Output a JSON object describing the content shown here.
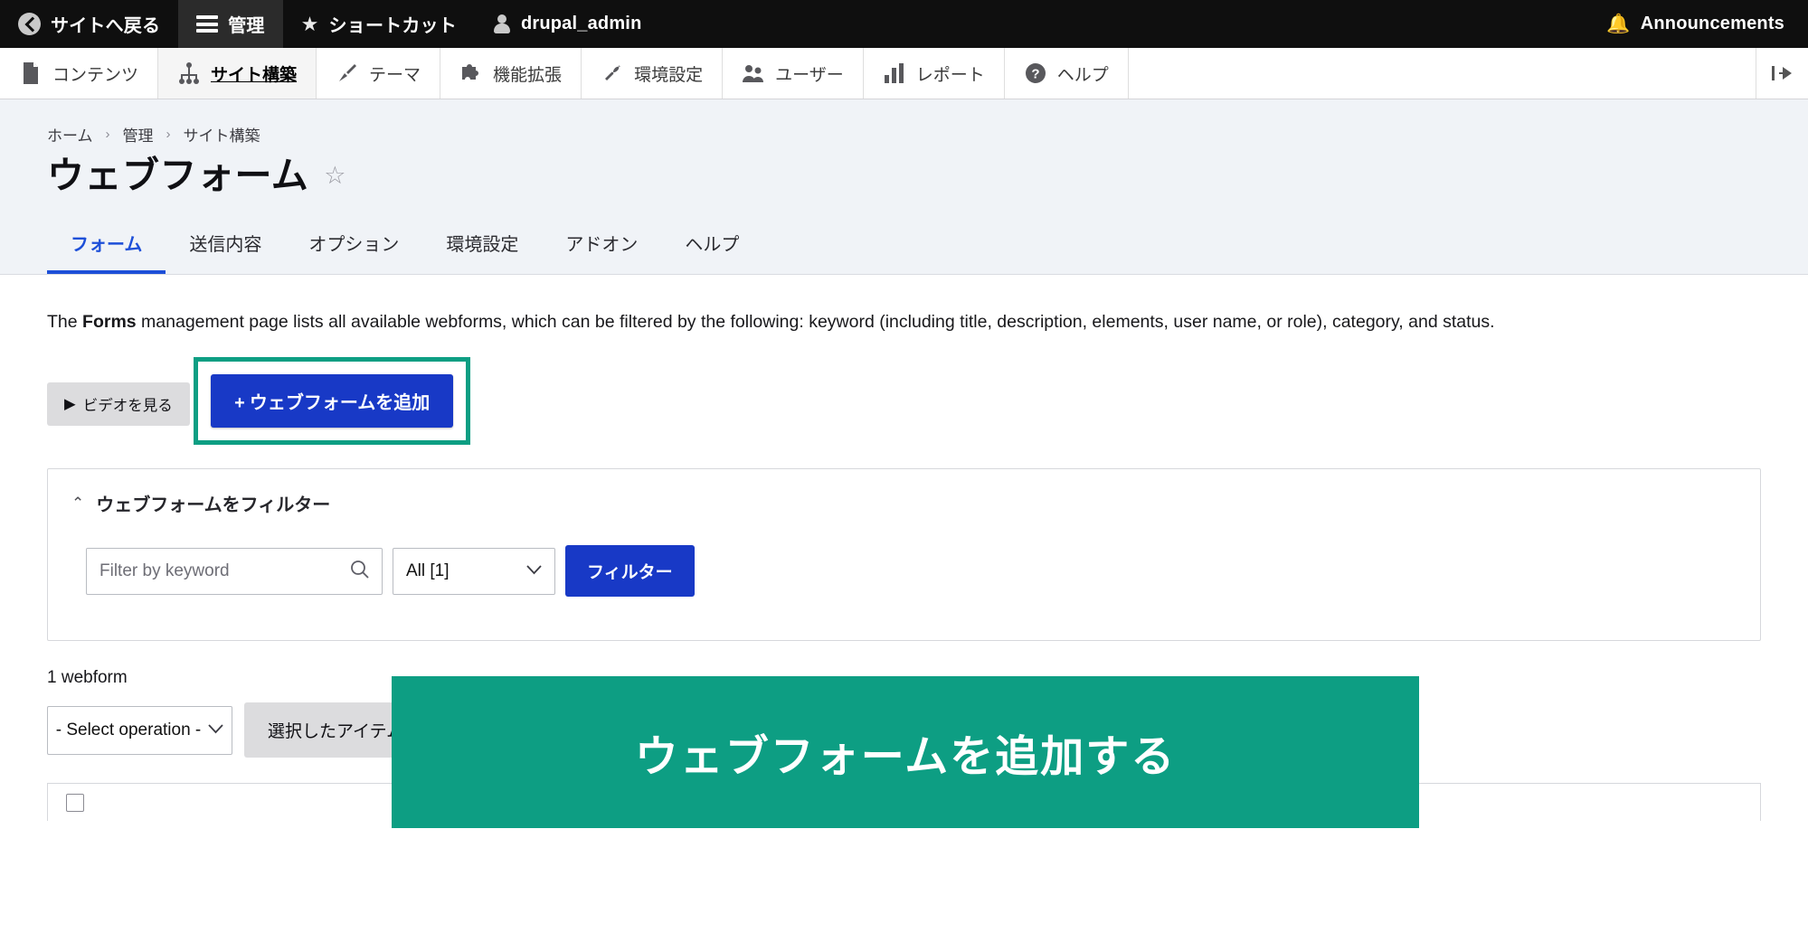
{
  "admin_bar": {
    "items": [
      {
        "icon": "back-arrow-icon",
        "label": "サイトへ戻る"
      },
      {
        "icon": "hamburger-icon",
        "label": "管理"
      },
      {
        "icon": "star-icon",
        "label": "ショートカット"
      },
      {
        "icon": "user-icon",
        "label": "drupal_admin"
      }
    ],
    "announcements": {
      "icon": "bell-icon",
      "label": "Announcements"
    }
  },
  "menu_bar": {
    "items": [
      {
        "icon": "document-icon",
        "label": "コンテンツ"
      },
      {
        "icon": "structure-icon",
        "label": "サイト構築"
      },
      {
        "icon": "paintbrush-icon",
        "label": "テーマ"
      },
      {
        "icon": "puzzle-icon",
        "label": "機能拡張"
      },
      {
        "icon": "wrench-icon",
        "label": "環境設定"
      },
      {
        "icon": "people-icon",
        "label": "ユーザー"
      },
      {
        "icon": "bar-chart-icon",
        "label": "レポート"
      },
      {
        "icon": "question-mark-icon",
        "label": "ヘルプ"
      }
    ],
    "collapse_icon": "collapse-panel-icon"
  },
  "breadcrumb": {
    "items": [
      "ホーム",
      "管理",
      "サイト構築"
    ],
    "separator": "›"
  },
  "page": {
    "title": "ウェブフォーム",
    "star_icon": "☆"
  },
  "tabs": [
    {
      "label": "フォーム",
      "active": true
    },
    {
      "label": "送信内容",
      "active": false
    },
    {
      "label": "オプション",
      "active": false
    },
    {
      "label": "環境設定",
      "active": false
    },
    {
      "label": "アドオン",
      "active": false
    },
    {
      "label": "ヘルプ",
      "active": false
    }
  ],
  "intro": {
    "prefix": "The ",
    "bold": "Forms",
    "suffix": " management page lists all available webforms, which can be filtered by the following: keyword (including title, description, elements, user name, or role), category, and status."
  },
  "video_button": {
    "icon": "▶",
    "label": "ビデオを見る"
  },
  "add_button": {
    "plus": "+",
    "label": "ウェブフォームを追加"
  },
  "filter_panel": {
    "collapse_icon": "⌃",
    "title": "ウェブフォームをフィルター",
    "keyword": {
      "value": "",
      "placeholder": "Filter by keyword",
      "icon": "search-icon"
    },
    "category": {
      "selected": "All [1]",
      "chevron": "⌄"
    },
    "submit_label": "フィルター"
  },
  "results": {
    "count_label": "1 webform",
    "operation_select": {
      "selected": "- Select operation -",
      "chevron": "⌄"
    },
    "apply_label": "選択したアイテムに適用"
  },
  "callout": {
    "text": "ウェブフォームを追加する",
    "color": "#0d9e83"
  },
  "colors": {
    "admin_bar_bg": "#0f0f0f",
    "primary_blue": "#1839c6",
    "tab_active": "#1d4fd8",
    "header_bg": "#f0f3f7",
    "accent_green": "#0d9e83"
  }
}
